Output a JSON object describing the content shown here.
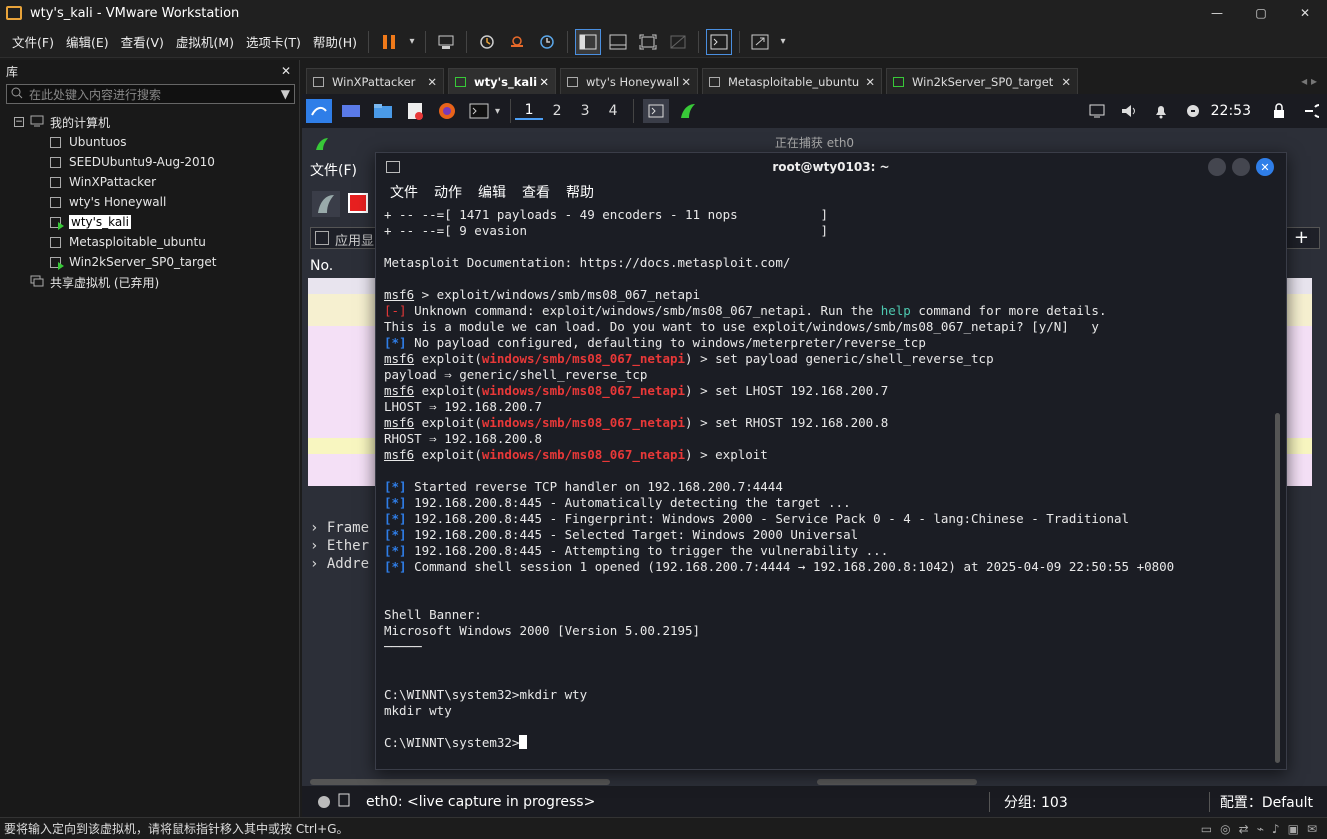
{
  "window": {
    "title": "wty's_kali - VMware Workstation",
    "controls": [
      "—",
      "▢",
      "✕"
    ]
  },
  "menu": [
    "文件(F)",
    "编辑(E)",
    "查看(V)",
    "虚拟机(M)",
    "选项卡(T)",
    "帮助(H)"
  ],
  "library": {
    "title": "库",
    "close": "✕",
    "search_placeholder": "在此处键入内容进行搜索",
    "root": "我的计算机",
    "vms": [
      {
        "name": "Ubuntuos",
        "running": false
      },
      {
        "name": "SEEDUbuntu9-Aug-2010",
        "running": false
      },
      {
        "name": "WinXPattacker",
        "running": false
      },
      {
        "name": "wty's Honeywall",
        "running": false
      },
      {
        "name": "wty's_kali",
        "running": true,
        "selected": true
      },
      {
        "name": "Metasploitable_ubuntu",
        "running": false
      },
      {
        "name": "Win2kServer_SP0_target",
        "running": true
      }
    ],
    "shared": "共享虚拟机 (已弃用)"
  },
  "tabs": [
    {
      "label": "WinXPattacker",
      "active": false
    },
    {
      "label": "wty's_kali",
      "active": true
    },
    {
      "label": "wty's Honeywall",
      "active": false
    },
    {
      "label": "Metasploitable_ubuntu",
      "active": false
    },
    {
      "label": "Win2kServer_SP0_target",
      "active": false
    }
  ],
  "kali_panel": {
    "workspaces": [
      "1",
      "2",
      "3",
      "4"
    ],
    "active_workspace": "1",
    "clock": "22:53"
  },
  "wireshark": {
    "title": "正在捕获 eth0",
    "menu": [
      "文件(F)"
    ],
    "filter_placeholder": "应用显",
    "col_no": "No.",
    "tree": [
      "Frame",
      "Ether",
      "Addre"
    ],
    "status_left": "eth0: <live capture in progress>",
    "status_packets": "分组: 103",
    "status_profile": "配置：Default"
  },
  "terminal": {
    "title": "root@wty0103: ~",
    "menu": [
      "文件",
      "动作",
      "编辑",
      "查看",
      "帮助"
    ]
  },
  "statusbar": {
    "text": "要将输入定向到该虚拟机，请将鼠标指针移入其中或按 Ctrl+G。"
  },
  "colors": {
    "accent_blue": "#2f7ee8",
    "error_red": "#e83838",
    "running_green": "#38c938"
  }
}
